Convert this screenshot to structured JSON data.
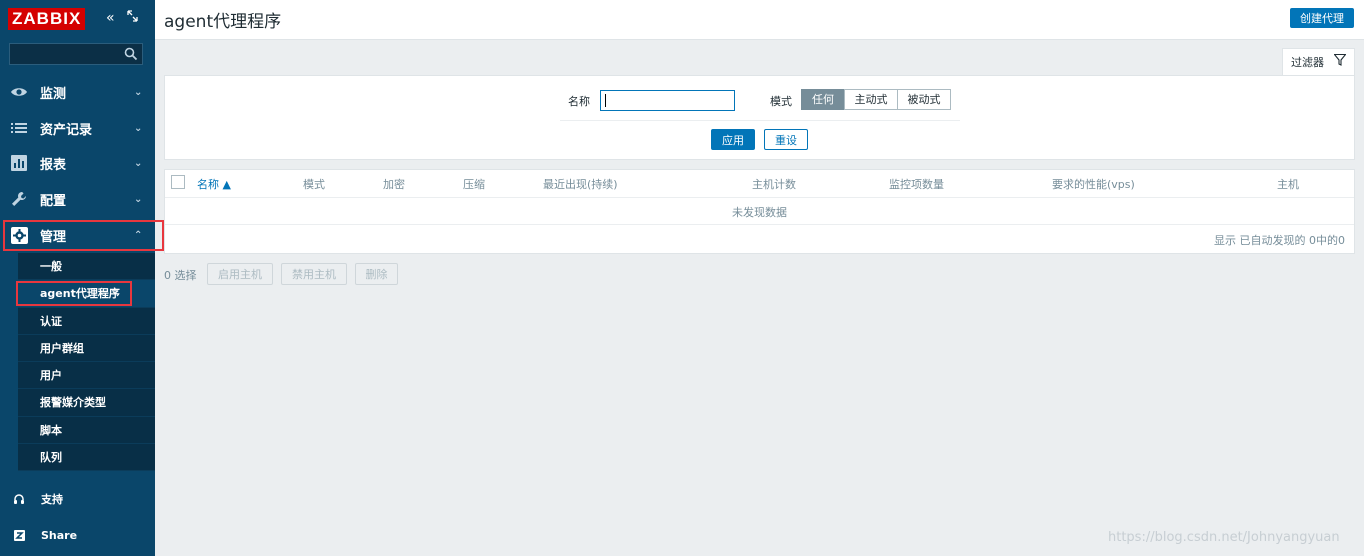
{
  "sidebar": {
    "logo": "ZABBIX",
    "menu": [
      {
        "label": "监测",
        "icon": "eye-icon"
      },
      {
        "label": "资产记录",
        "icon": "list-icon"
      },
      {
        "label": "报表",
        "icon": "bar-chart-icon"
      },
      {
        "label": "配置",
        "icon": "wrench-icon"
      },
      {
        "label": "管理",
        "icon": "gear-icon"
      }
    ],
    "submenu": [
      "一般",
      "agent代理程序",
      "认证",
      "用户群组",
      "用户",
      "报警媒介类型",
      "脚本",
      "队列"
    ],
    "bottom": [
      {
        "label": "支持",
        "icon": "headset-icon"
      },
      {
        "label": "Share",
        "icon": "share-icon"
      }
    ]
  },
  "header": {
    "title": "agent代理程序",
    "create_label": "创建代理"
  },
  "filter": {
    "tab_label": "过滤器",
    "name_label": "名称",
    "name_value": "",
    "mode_label": "模式",
    "mode_options": [
      "任何",
      "主动式",
      "被动式"
    ],
    "mode_selected": "任何",
    "apply_label": "应用",
    "reset_label": "重设"
  },
  "table": {
    "columns": [
      "名称 ▲",
      "模式",
      "加密",
      "压缩",
      "最近出现(持续)",
      "主机计数",
      "监控项数量",
      "要求的性能(vps)",
      "主机"
    ],
    "no_data": "未发现数据",
    "paging": "显示 已自动发现的 0中的0"
  },
  "actions": {
    "selected": "0 选择",
    "enable_hosts": "启用主机",
    "disable_hosts": "禁用主机",
    "delete": "删除"
  },
  "colors": {
    "sidebar_bg": "#0a466a",
    "accent": "#0275b8",
    "highlight_box": "#e8373e",
    "logo_red": "#d40000"
  },
  "watermark": "https://blog.csdn.net/Johnyangyuan"
}
